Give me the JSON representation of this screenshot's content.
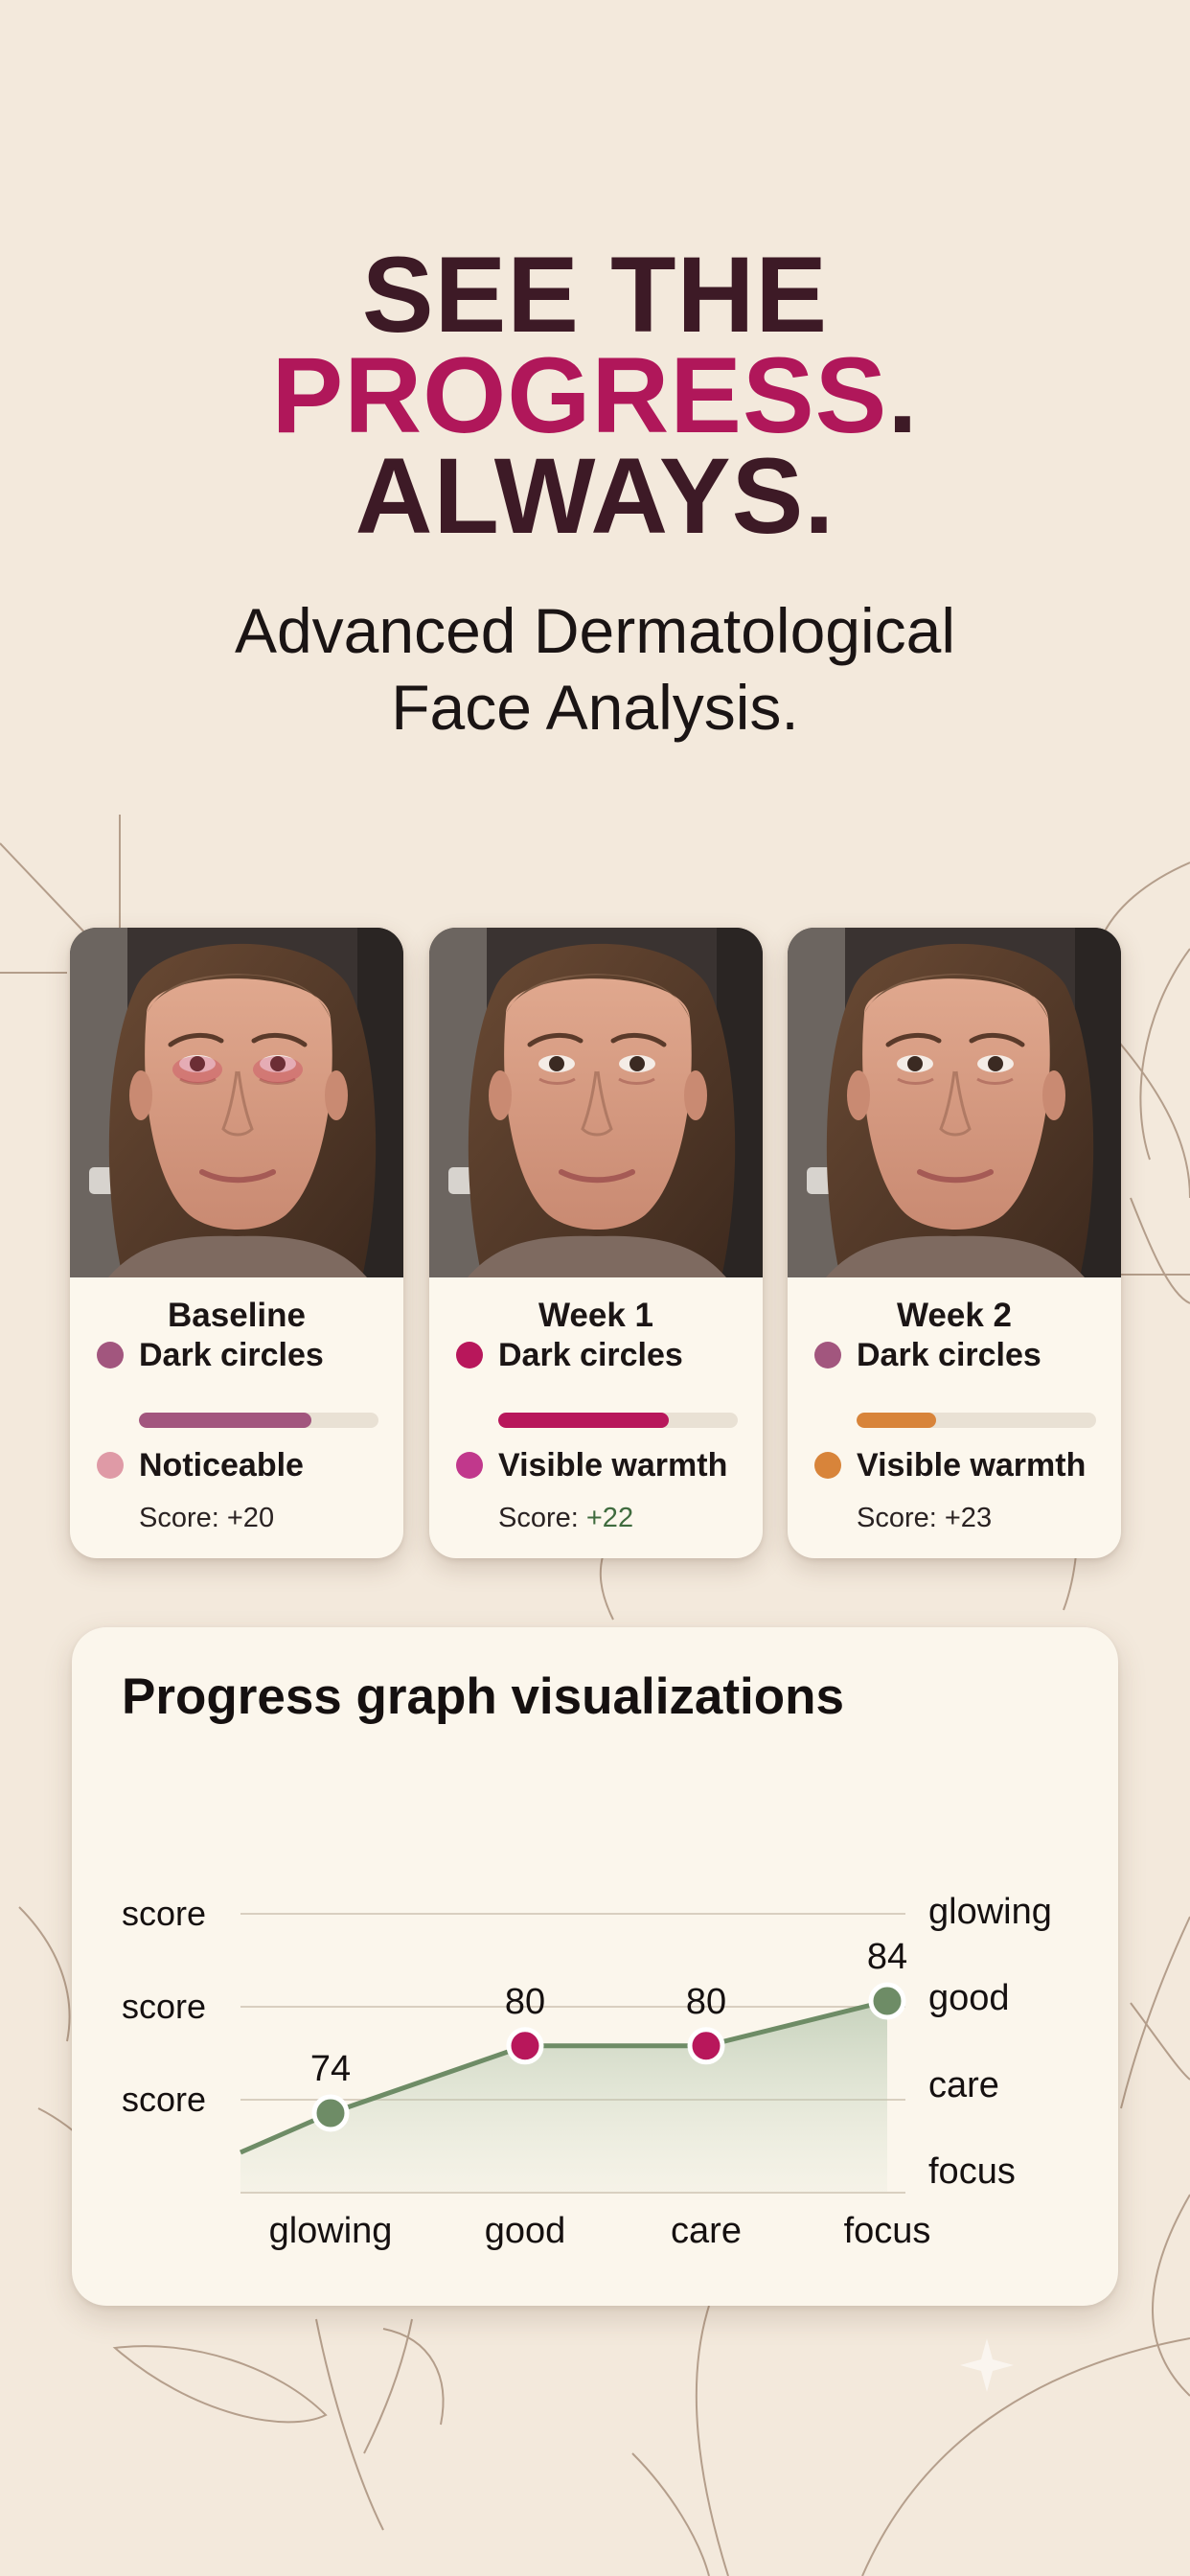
{
  "hero": {
    "line1": "SEE THE",
    "line2_accent": "PROGRESS",
    "line2_dot": ".",
    "line3": "ALWAYS.",
    "subtitle_line1": "Advanced Dermatological",
    "subtitle_line2": "Face Analysis."
  },
  "colors": {
    "background": "#f3e9dc",
    "headline": "#3d1a26",
    "accent": "#b0175a",
    "line_green": "#6e8c66",
    "point_magenta": "#b8175b"
  },
  "cards": [
    {
      "title": "Baseline",
      "metric1": {
        "label": "Dark circles",
        "dot_color": "#a2567e"
      },
      "bar": {
        "fill_fraction": 0.72,
        "color": "#a2567e"
      },
      "metric2": {
        "label": "Noticeable",
        "dot_color": "#df9aa6"
      },
      "score_prefix": "Score: ",
      "score_value": "+20",
      "score_green": false
    },
    {
      "title": "Week 1",
      "metric1": {
        "label": "Dark circles",
        "dot_color": "#b8175b"
      },
      "bar": {
        "fill_fraction": 0.71,
        "color": "#b8175b"
      },
      "metric2": {
        "label": "Visible warmth",
        "dot_color": "#c1388c"
      },
      "score_prefix": "Score: ",
      "score_value": "+22",
      "score_green": true
    },
    {
      "title": "Week 2",
      "metric1": {
        "label": "Dark circles",
        "dot_color": "#a2567e"
      },
      "bar": {
        "fill_fraction": 0.33,
        "color": "#d8843a"
      },
      "metric2": {
        "label": "Visible warmth",
        "dot_color": "#d8843a"
      },
      "score_prefix": "Score: ",
      "score_value": "+23",
      "score_green": false
    }
  ],
  "graph": {
    "title": "Progress graph visualizations",
    "left_labels": [
      "score",
      "score",
      "score"
    ],
    "right_labels": [
      "glowing",
      "good",
      "care",
      "focus"
    ],
    "x_labels": [
      "glowing",
      "good",
      "care",
      "focus"
    ],
    "points": [
      {
        "value": 74,
        "label": "74",
        "color": "#6e8c66"
      },
      {
        "value": 80,
        "label": "80",
        "color": "#b8175b"
      },
      {
        "value": 80,
        "label": "80",
        "color": "#b8175b"
      },
      {
        "value": 84,
        "label": "84",
        "color": "#6e8c66"
      }
    ]
  }
}
